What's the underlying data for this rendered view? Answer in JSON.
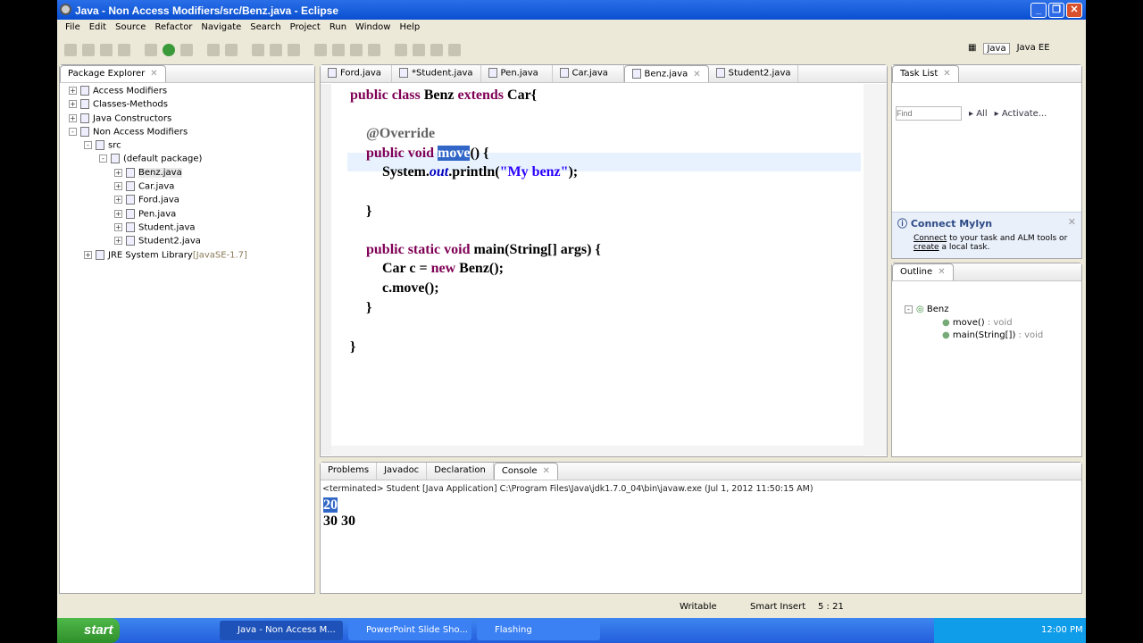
{
  "window": {
    "title": "Java - Non Access Modifiers/src/Benz.java - Eclipse"
  },
  "menu": [
    "File",
    "Edit",
    "Source",
    "Refactor",
    "Navigate",
    "Search",
    "Project",
    "Run",
    "Window",
    "Help"
  ],
  "perspectives": [
    "Java",
    "Java EE"
  ],
  "package_explorer": {
    "title": "Package Explorer",
    "items": [
      {
        "label": "Access Modifiers",
        "level": 0,
        "pm": "+"
      },
      {
        "label": "Classes-Methods",
        "level": 0,
        "pm": "+"
      },
      {
        "label": "Java Constructors",
        "level": 0,
        "pm": "+"
      },
      {
        "label": "Non Access Modifiers",
        "level": 0,
        "pm": "-"
      },
      {
        "label": "src",
        "level": 1,
        "pm": "-"
      },
      {
        "label": "(default package)",
        "level": 2,
        "pm": "-"
      },
      {
        "label": "Benz.java",
        "level": 3,
        "pm": "+"
      },
      {
        "label": "Car.java",
        "level": 3,
        "pm": "+"
      },
      {
        "label": "Ford.java",
        "level": 3,
        "pm": "+"
      },
      {
        "label": "Pen.java",
        "level": 3,
        "pm": "+"
      },
      {
        "label": "Student.java",
        "level": 3,
        "pm": "+"
      },
      {
        "label": "Student2.java",
        "level": 3,
        "pm": "+"
      },
      {
        "label": "JRE System Library",
        "suffix": "[JavaSE-1.7]",
        "level": 1,
        "pm": "+"
      }
    ]
  },
  "editor": {
    "tabs": [
      "Ford.java",
      "*Student.java",
      "Pen.java",
      "Car.java",
      "Benz.java",
      "Student2.java"
    ],
    "active": 4,
    "lines": [
      {
        "parts": [
          [
            "kw",
            "public class "
          ],
          [
            "",
            "Benz "
          ],
          [
            "kw",
            "extends "
          ],
          [
            "",
            "Car{"
          ]
        ]
      },
      {
        "parts": [
          [
            "an",
            "@Override"
          ]
        ]
      },
      {
        "parts": [
          [
            "kw",
            "public void "
          ],
          [
            "sel",
            "move"
          ],
          [
            "",
            "() {"
          ]
        ]
      },
      {
        "parts": [
          [
            "",
            "System."
          ],
          [
            "it",
            "out"
          ],
          [
            "",
            ".println("
          ],
          [
            "st",
            "\"My benz\""
          ],
          [
            "",
            ");"
          ]
        ]
      },
      {
        "parts": [
          [
            "",
            "}"
          ]
        ]
      },
      {
        "parts": [
          [
            "kw",
            "public static void "
          ],
          [
            "",
            "main(String[] args) {"
          ]
        ]
      },
      {
        "parts": [
          [
            "",
            "Car c = "
          ],
          [
            "kw",
            "new "
          ],
          [
            "",
            "Benz();"
          ]
        ]
      },
      {
        "parts": [
          [
            "",
            "c.move();"
          ]
        ]
      },
      {
        "parts": [
          [
            "",
            "}"
          ]
        ]
      },
      {
        "parts": [
          [
            "",
            "}"
          ]
        ]
      }
    ]
  },
  "task_list": {
    "title": "Task List",
    "find_placeholder": "Find",
    "all": "All",
    "activate": "Activate...",
    "mylyn_title": "Connect Mylyn",
    "mylyn_connect": "Connect",
    "mylyn_text1": " to your task and ALM tools or",
    "mylyn_create": "create",
    "mylyn_text2": " a local task."
  },
  "outline": {
    "title": "Outline",
    "class": "Benz",
    "members": [
      {
        "name": "move()",
        "type": " : void"
      },
      {
        "name": "main(String[])",
        "type": " : void"
      }
    ]
  },
  "console": {
    "tabs": [
      "Problems",
      "Javadoc",
      "Declaration",
      "Console"
    ],
    "header": "<terminated> Student [Java Application] C:\\Program Files\\Java\\jdk1.7.0_04\\bin\\javaw.exe (Jul 1, 2012 11:50:15 AM)",
    "out1": "20",
    "out2": "30 30"
  },
  "status": {
    "writable": "Writable",
    "insert": "Smart Insert",
    "position": "5 : 21"
  },
  "taskbar": {
    "start": "start",
    "buttons": [
      "Java - Non Access M...",
      "PowerPoint Slide Sho...",
      "Flashing"
    ],
    "clock": "12:00 PM"
  }
}
